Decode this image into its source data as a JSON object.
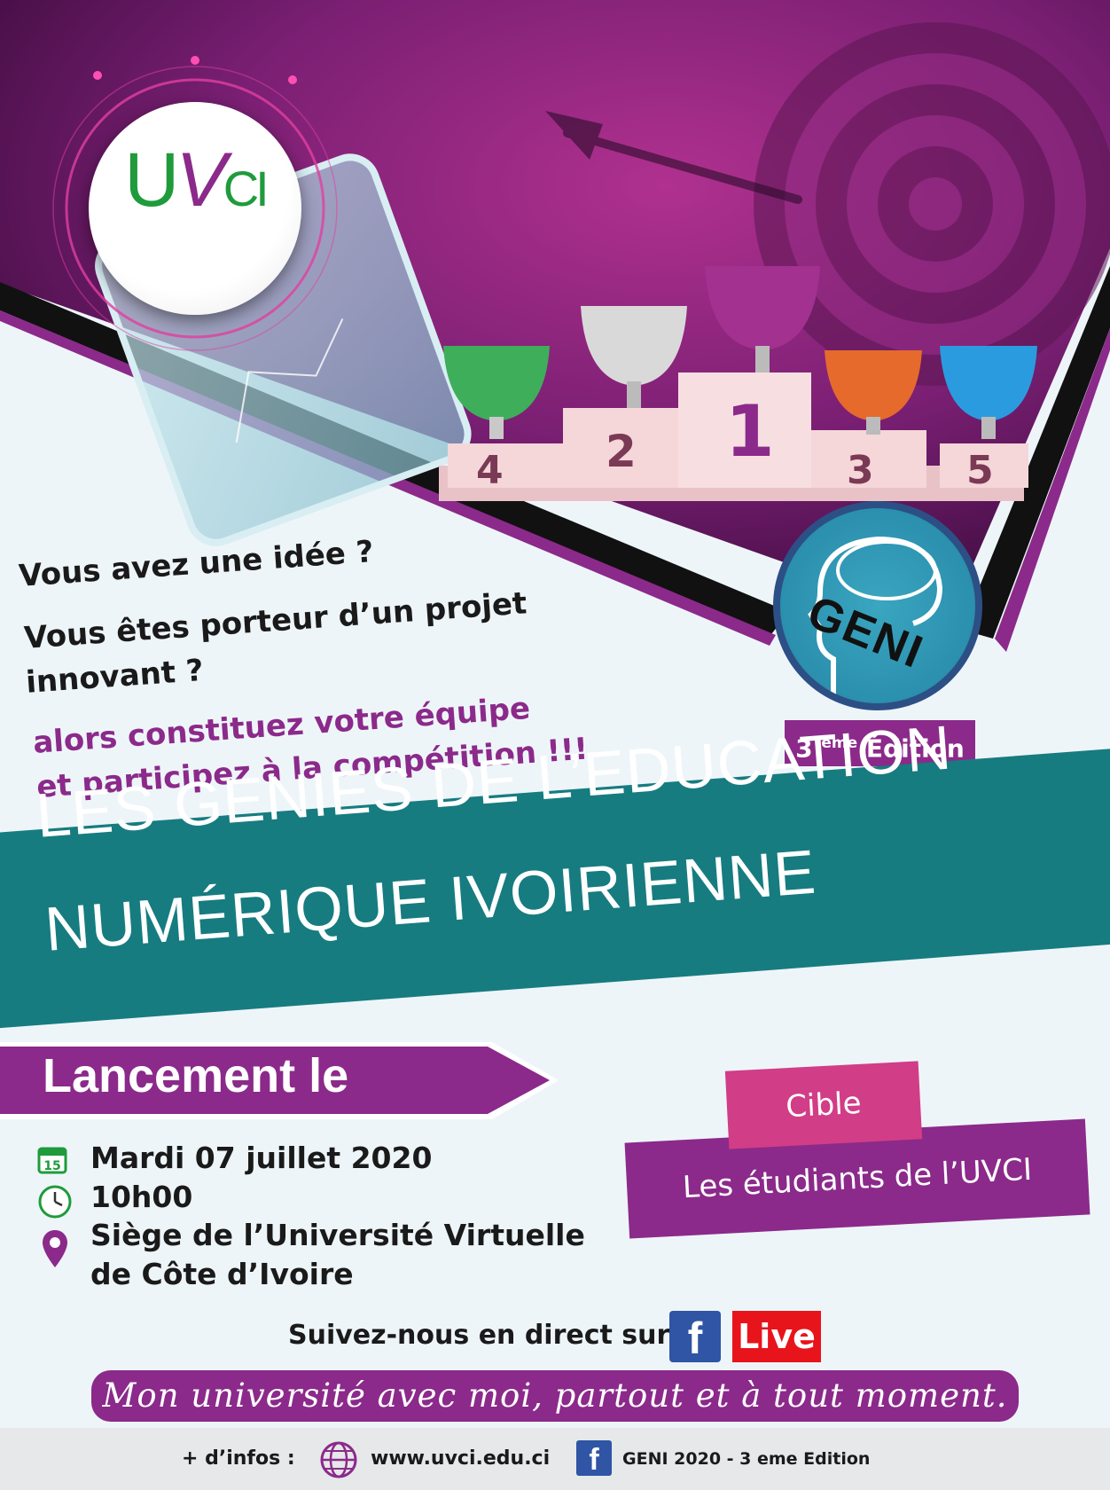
{
  "logo": {
    "u": "U",
    "v": "V",
    "ci": "CI"
  },
  "geni_logo": {
    "text": "GENI"
  },
  "edition": {
    "number": "3",
    "sup": "ème",
    "word": "Édition"
  },
  "questions": {
    "q1": "Vous avez une idée ?",
    "q2_line1": "Vous êtes porteur d’un projet",
    "q2_line2": "innovant ?",
    "prompt_line1": "alors constituez votre équipe",
    "prompt_line2": "et participez à la compétition !!!"
  },
  "podium_numbers": [
    "4",
    "2",
    "1",
    "3",
    "5"
  ],
  "title": {
    "line1": "LES GENIES DE L’EDUCATION",
    "line2": "NUMÉRIQUE IVOIRIENNE"
  },
  "launch": {
    "label": "Lancement le"
  },
  "event": {
    "calendar_day": "15",
    "date": "Mardi 07 juillet 2020",
    "time": "10h00",
    "place_line1": "Siège de l’Université Virtuelle",
    "place_line2": "de Côte d’Ivoire"
  },
  "target": {
    "label": "Cible",
    "value": "Les étudiants de l’UVCI"
  },
  "follow": {
    "text": "Suivez-nous en direct sur",
    "fb": "f",
    "live": "Live"
  },
  "slogan": "Mon université avec moi, partout et à tout moment.",
  "footer": {
    "infos": "+ d’infos :",
    "website": "www.uvci.edu.ci",
    "fb_page": "GENI 2020 - 3 eme Edition"
  },
  "colors": {
    "purple": "#8b2a8a",
    "teal": "#167c80",
    "pink": "#d13d87",
    "green": "#1f9b3b"
  },
  "icons": [
    "calendar-icon",
    "clock-icon",
    "location-pin-icon",
    "globe-icon",
    "facebook-icon",
    "brain-head-icon",
    "dart-target-icon",
    "trophy-icon"
  ]
}
